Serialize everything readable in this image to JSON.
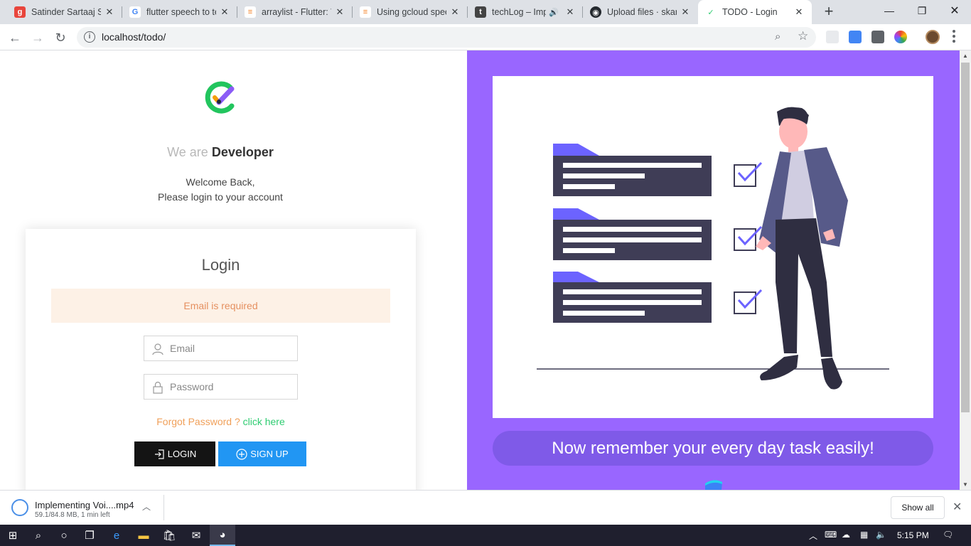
{
  "browser": {
    "tabs": [
      {
        "title": "Satinder Sartaaj So",
        "favicon": "g-icon",
        "favicon_color": "#e8453c",
        "glyph": "g"
      },
      {
        "title": "flutter speech to te",
        "favicon": "google-icon",
        "favicon_color": "#4285f4",
        "glyph": "G"
      },
      {
        "title": "arraylist - Flutter: V",
        "favicon": "stackoverflow-icon",
        "favicon_color": "#f48024",
        "glyph": "≡"
      },
      {
        "title": "Using gcloud spee",
        "favicon": "stackoverflow-icon",
        "favicon_color": "#f48024",
        "glyph": "≡"
      },
      {
        "title": "techLog – Imp",
        "favicon": "techlog-icon",
        "favicon_color": "#444444",
        "glyph": "t"
      },
      {
        "title": "Upload files · skara",
        "favicon": "github-icon",
        "favicon_color": "#24292e",
        "glyph": "◉"
      },
      {
        "title": "TODO - Login",
        "favicon": "todo-logo-icon",
        "favicon_color": "#2ecc71",
        "glyph": "✓"
      }
    ],
    "url": "localhost/todo/"
  },
  "page": {
    "tagline_prefix": "We are",
    "tagline_bold": "Developer",
    "welcome_line1": "Welcome Back,",
    "welcome_line2": "Please login to your account",
    "login": {
      "title": "Login",
      "error": "Email is required",
      "email_placeholder": "Email",
      "password_placeholder": "Password",
      "forgot_text": "Forgot Password ?",
      "forgot_link": "click here",
      "login_button": "LOGIN",
      "signup_button": "SIGN UP"
    },
    "slogan": "Now remember your every day task easily!"
  },
  "downloads": {
    "file_name": "Implementing Voi....mp4",
    "status": "59.1/84.8 MB, 1 min left",
    "show_all": "Show all"
  },
  "taskbar": {
    "time": "5:15 PM"
  },
  "colors": {
    "accent_purple": "#9966ff",
    "slogan_pill": "#7f5ae8",
    "login_button": "#141414",
    "signup_button": "#2196f3",
    "error_text": "#e59060",
    "link_green": "#2ecc71"
  }
}
